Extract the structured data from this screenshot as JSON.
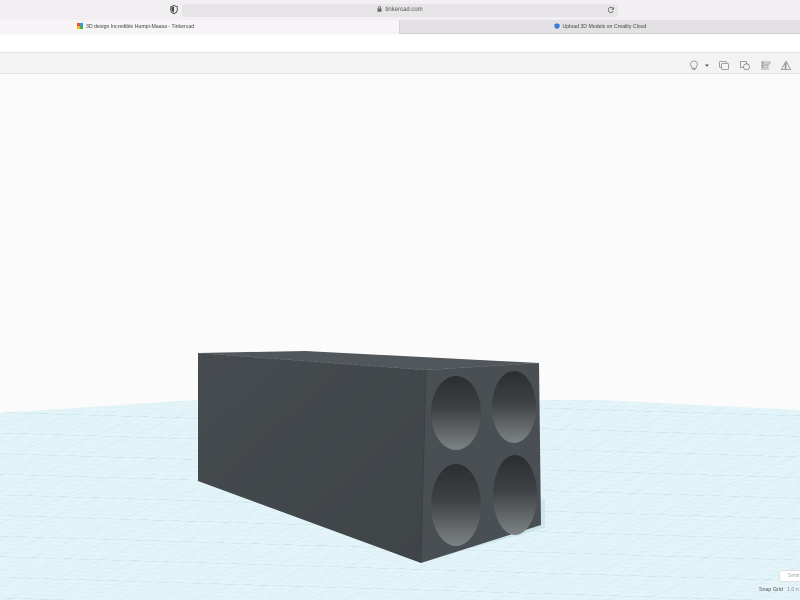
{
  "browser": {
    "url": "tinkercad.com",
    "tabs": [
      {
        "label": "3D design Incredible Humpi-Maasa - Tinkercad",
        "favicon": "tinkercad-logo-icon",
        "active": true
      },
      {
        "label": "Upload 3D Models on Creality Cloud",
        "favicon": "creality-cloud-icon",
        "active": false
      }
    ]
  },
  "toolbar": {
    "icons": [
      "lightbulb-icon",
      "dropdown-caret-icon",
      "comment-icon",
      "note-icon",
      "align-icon",
      "flip-icon"
    ]
  },
  "workplane": {
    "settings_label": "Settin",
    "snap_grid_label": "Snap Grid",
    "snap_grid_value": "1.0 n"
  },
  "model": {
    "shape": "rectangular-box-with-four-holes",
    "color": "#4b5054"
  },
  "colors": {
    "grid": "#bfe6ee",
    "grid_major": "#a6d8e4",
    "background": "#fbfbfb"
  }
}
